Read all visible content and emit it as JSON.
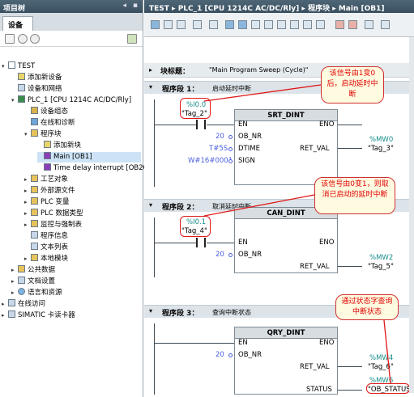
{
  "left_panel": {
    "title": "项目树",
    "tab": "设备",
    "tree": [
      {
        "label": "TEST",
        "expander": "▾"
      },
      {
        "label": "添加新设备",
        "expander": ""
      },
      {
        "label": "设备和网络",
        "expander": ""
      },
      {
        "label": "PLC_1 [CPU 1214C AC/DC/Rly]",
        "expander": "▾"
      },
      {
        "label": "设备组态",
        "expander": ""
      },
      {
        "label": "在线和诊断",
        "expander": ""
      },
      {
        "label": "程序块",
        "expander": "▾"
      },
      {
        "label": "添加新块",
        "expander": ""
      },
      {
        "label": "Main [OB1]",
        "expander": ""
      },
      {
        "label": "Time delay interrupt [OB20]",
        "expander": ""
      },
      {
        "label": "工艺对象",
        "expander": "▸"
      },
      {
        "label": "外部源文件",
        "expander": "▸"
      },
      {
        "label": "PLC 变量",
        "expander": "▸"
      },
      {
        "label": "PLC 数据类型",
        "expander": "▸"
      },
      {
        "label": "监控与强制表",
        "expander": "▸"
      },
      {
        "label": "程序信息",
        "expander": ""
      },
      {
        "label": "文本列表",
        "expander": ""
      },
      {
        "label": "本地模块",
        "expander": "▸"
      },
      {
        "label": "公共数据",
        "expander": "▸"
      },
      {
        "label": "文档设置",
        "expander": "▸"
      },
      {
        "label": "语言和资源",
        "expander": "▸"
      },
      {
        "label": "在线访问",
        "expander": "▸"
      },
      {
        "label": "SIMATIC 卡读卡器",
        "expander": "▸"
      }
    ]
  },
  "editor": {
    "breadcrumb": "TEST ▸ PLC_1 [CPU 1214C AC/DC/Rly] ▸ 程序块 ▸ Main [OB1]",
    "block_title_label": "块标题：",
    "block_title_value": "\"Main Program Sweep (Cycle)\"",
    "networks": [
      {
        "label": "程序段 1：",
        "comment": "启动延时中断",
        "contact_addr": "%I0.0",
        "contact_tag": "\"Tag_2\"",
        "block": "SRT_DINT",
        "pins": [
          "EN",
          "OB_NR",
          "DTIME",
          "SIGN",
          "ENO",
          "RET_VAL"
        ],
        "inputs": [
          "20",
          "T#5S",
          "W#16#0001"
        ],
        "out_addr": "%MW0",
        "out_tag": "\"Tag_3\"",
        "note": "该信号由1变0后，启动延时中断"
      },
      {
        "label": "程序段 2：",
        "comment": "取消延时中断",
        "contact_addr": "%I0.1",
        "contact_tag": "\"Tag_4\"",
        "block": "CAN_DINT",
        "pins": [
          "EN",
          "OB_NR",
          "ENO",
          "RET_VAL"
        ],
        "inputs": [
          "20"
        ],
        "out_addr": "%MW2",
        "out_tag": "\"Tag_5\"",
        "note": "该信号由0变1，则取消已启动的延时中断"
      },
      {
        "label": "程序段 3：",
        "comment": "查询中断状态",
        "block": "QRY_DINT",
        "pins": [
          "EN",
          "OB_NR",
          "ENO",
          "RET_VAL",
          "STATUS"
        ],
        "inputs": [
          "20"
        ],
        "out_addr": "%MW4",
        "out_tag": "\"Tag_6\"",
        "out2_addr": "%MW6",
        "out2_tag": "\"OB_STATUS\"",
        "note": "通过状态字查询中断状态"
      }
    ]
  }
}
